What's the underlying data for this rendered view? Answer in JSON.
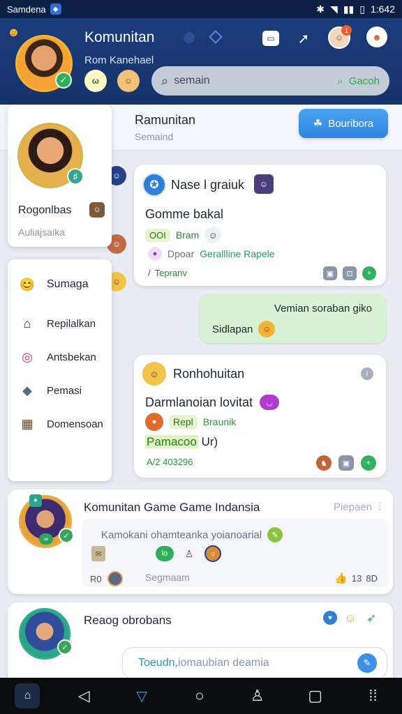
{
  "statusbar": {
    "carrier": "Samdena",
    "clock": "1:642"
  },
  "header": {
    "title": "Komunitan",
    "subtitle": "Rom Kanehael",
    "chip_a": "ω",
    "search": {
      "placeholder": "semain",
      "action_label": "Gacoh"
    },
    "notif_count": "1"
  },
  "subbar": {
    "title": "Ramunitan",
    "subtitle": "Semaind",
    "button_label": "Bouribora"
  },
  "profile": {
    "name": "Rogonlbas",
    "handle": "Auliajsaika"
  },
  "menu": {
    "items": [
      {
        "label": "Sumaga",
        "icon": "emoji-icon"
      },
      {
        "label": "Repilalkan",
        "icon": "home-icon"
      },
      {
        "label": "Antsbekan",
        "icon": "link-icon"
      },
      {
        "label": "Pemasi",
        "icon": "diamond-icon"
      },
      {
        "label": "Domensoan",
        "icon": "image-icon"
      }
    ]
  },
  "posts": [
    {
      "title": "Nase l graiuk",
      "line1": "Gomme bakal",
      "pill": "OOI",
      "pill_text": "Bram",
      "row3_a": "Dpoar",
      "row3_b": "Gerallline Rapele",
      "row4": "Tepranv"
    }
  ],
  "bubble": {
    "line1": "Vemian soraban giko",
    "line2": "Sidlapan"
  },
  "post2": {
    "title": "Ronhohuitan",
    "line1": "Darmlanoian lovitat",
    "pill": "Repl",
    "green": "Braunik",
    "line3_highlight": "Pamacoo",
    "line3_rest": "Ur)",
    "meta": "A/2 403296"
  },
  "communities": [
    {
      "title": "Komunitan Game Game Indansia",
      "time": "Piepaen",
      "preview": "Kamokani ohamteanka yoianoarial",
      "pill": "lo",
      "bottom_left": "R0",
      "bottom_mid": "Segmaam",
      "likes": "13",
      "comments": "8D"
    },
    {
      "title": "Reaog obrobans",
      "input_value": "Toeudn,",
      "input_rest": "iomaubian deamia"
    }
  ],
  "colors": {
    "header_bg": "#1b3d7c",
    "accent": "#2f86de",
    "green": "#32b05e"
  }
}
